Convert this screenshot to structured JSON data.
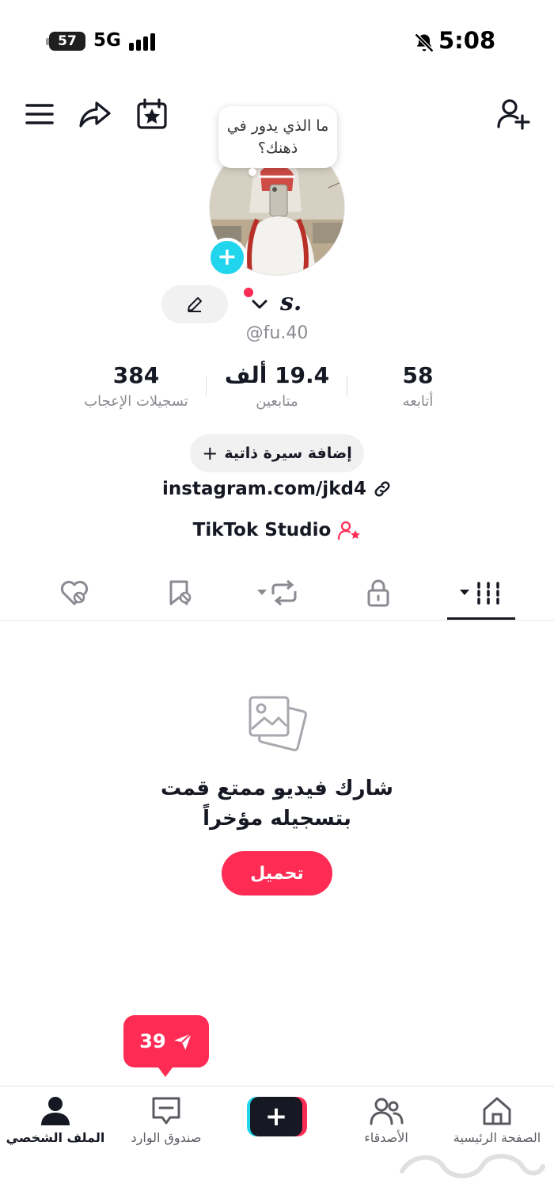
{
  "status_bar": {
    "battery": "57",
    "network": "5G",
    "time": "5:08"
  },
  "profile": {
    "bubble_text": "ما الذي يدور في ذهنك؟",
    "avatar_add": "+",
    "display_name": "s.",
    "username": "@fu.40",
    "stats": [
      {
        "value": "58",
        "label": "أتابعه"
      },
      {
        "value": "19.4 ألف",
        "label": "متابعين"
      },
      {
        "value": "384",
        "label": "تسجيلات الإعجاب"
      }
    ],
    "add_bio": {
      "icon": "+",
      "label": "إضافة سيرة ذاتية"
    },
    "link": "instagram.com/jkd4",
    "studio": "TikTok Studio"
  },
  "tabs": [
    {
      "name": "videos-tab",
      "icon": "grid-dropdown-icon",
      "active": true
    },
    {
      "name": "private-tab",
      "icon": "lock-icon"
    },
    {
      "name": "reposts-tab",
      "icon": "repost-dropdown-icon"
    },
    {
      "name": "favorites-tab",
      "icon": "bookmark-hidden-icon"
    },
    {
      "name": "liked-tab",
      "icon": "heart-hidden-icon"
    }
  ],
  "empty_state": {
    "icon": "photos-icon",
    "text": "شارك فيديو ممتع قمت بتسجيله مؤخراً",
    "button": "تحميل"
  },
  "inbox_badge": {
    "count": "39",
    "icon": "send-icon"
  },
  "bottom_nav": {
    "home": "الصفحة الرئيسية",
    "friends": "الأصدقاء",
    "create": "+",
    "inbox": "صندوق الوارد",
    "profile": "الملف الشخصي"
  },
  "colors": {
    "accent": "#fe2c55",
    "cyan": "#20d5ec",
    "text": "#161823",
    "muted": "#8a8b91"
  }
}
